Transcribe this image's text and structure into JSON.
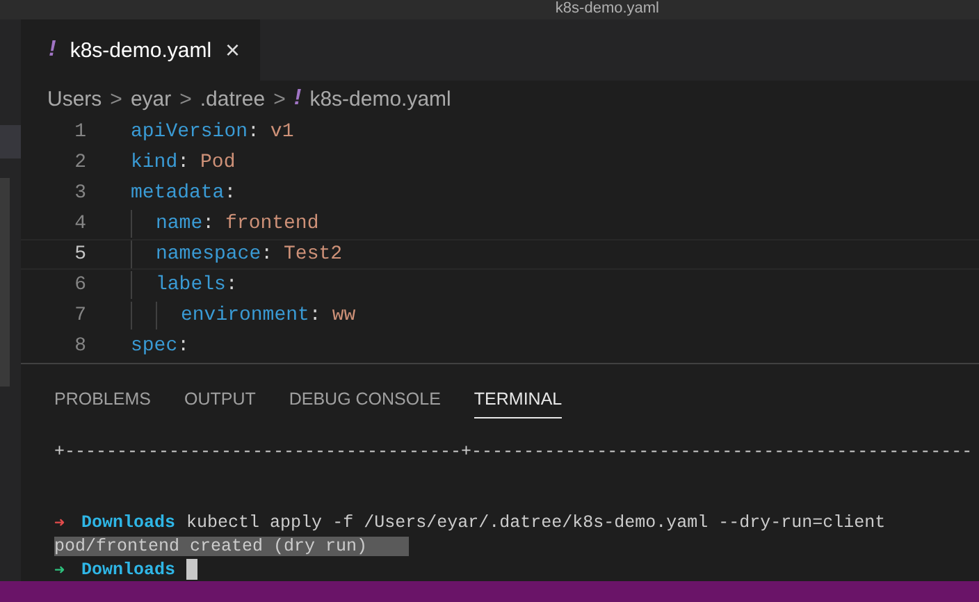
{
  "window": {
    "title": "k8s-demo.yaml"
  },
  "tabs": [
    {
      "label": "k8s-demo.yaml",
      "icon": "!",
      "close": "×",
      "selected": true
    }
  ],
  "breadcrumb": [
    {
      "label": "Users"
    },
    {
      "label": "eyar"
    },
    {
      "label": ".datree"
    },
    {
      "label": "k8s-demo.yaml",
      "icon": "!"
    }
  ],
  "breadcrumb_separator": ">",
  "key_separator": ":",
  "code": [
    {
      "number": "1",
      "key": "apiVersion",
      "value": "v1",
      "current": false
    },
    {
      "number": "2",
      "key": "kind",
      "value": "Pod",
      "current": false
    },
    {
      "number": "3",
      "key": "metadata",
      "current": false,
      "children": [
        {
          "number": "4",
          "key": "name",
          "value": "frontend",
          "current": false
        },
        {
          "number": "5",
          "key": "namespace",
          "value": "Test2",
          "current": true
        },
        {
          "number": "6",
          "key": "labels",
          "current": false,
          "children": [
            {
              "number": "7",
              "key": "environment",
              "value": "ww",
              "current": false
            }
          ]
        }
      ]
    },
    {
      "number": "8",
      "key": "spec",
      "current": false
    }
  ],
  "panel_tabs": [
    {
      "label": "PROBLEMS",
      "selected": false
    },
    {
      "label": "OUTPUT",
      "selected": false
    },
    {
      "label": "DEBUG CONSOLE",
      "selected": false
    },
    {
      "label": "TERMINAL",
      "selected": true
    }
  ],
  "terminal": [
    {
      "kind": "plain",
      "text": "+--------------------------------------+------------------------------------------------"
    },
    {
      "kind": "blank"
    },
    {
      "kind": "prompt",
      "arrow": "➜",
      "success": false,
      "dir": "Downloads",
      "command": "kubectl apply -f /Users/eyar/.datree/k8s-demo.yaml --dry-run=client"
    },
    {
      "kind": "selected",
      "text": "pod/frontend created (dry run)"
    },
    {
      "kind": "prompt",
      "arrow": "➜",
      "success": true,
      "dir": "Downloads",
      "cursor": true
    }
  ]
}
